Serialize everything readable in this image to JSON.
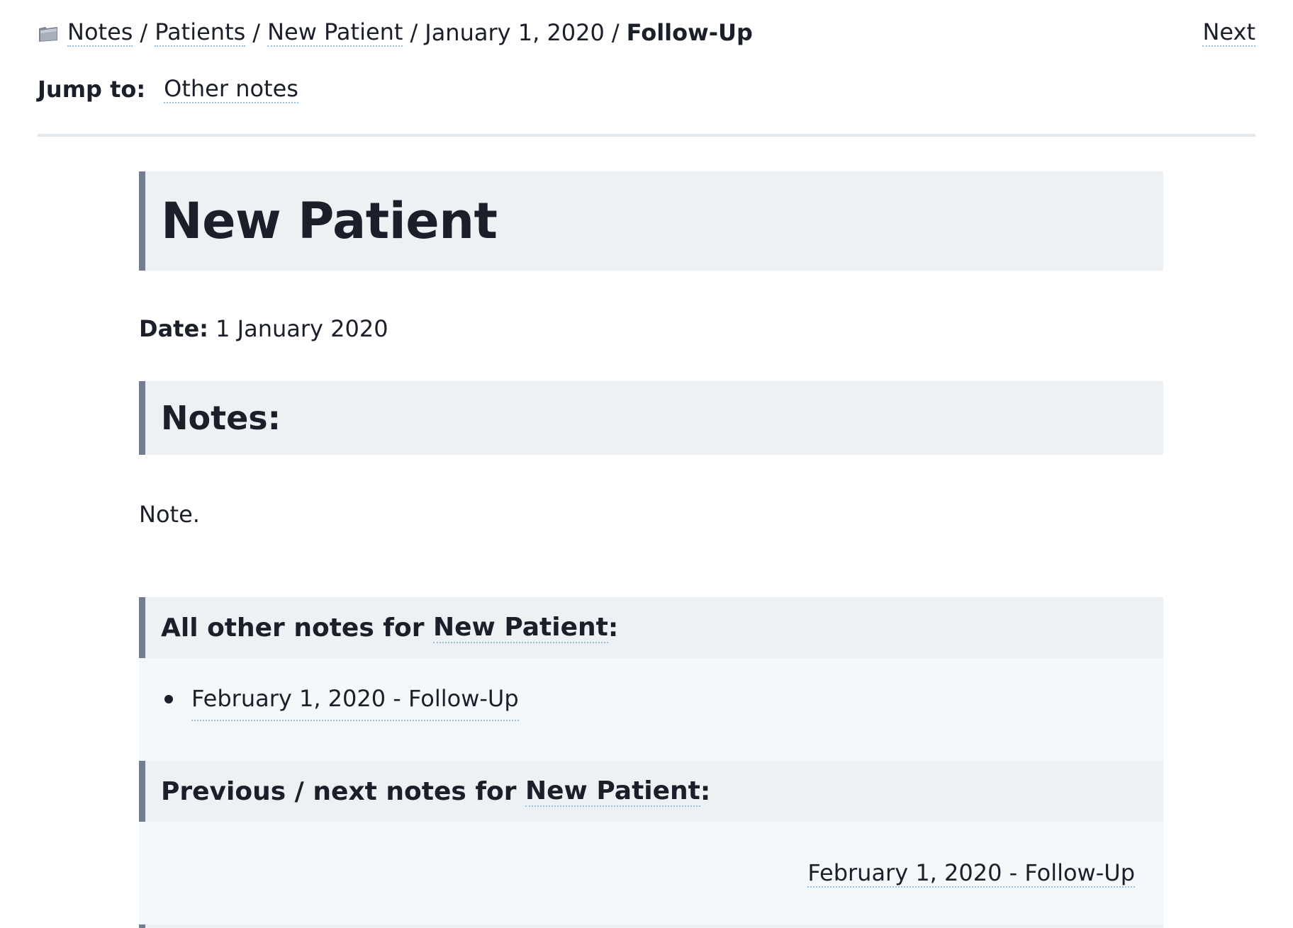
{
  "breadcrumb": {
    "icon": "folder-icon",
    "items": [
      "Notes",
      "Patients",
      "New Patient",
      "January 1, 2020"
    ],
    "separator": "/",
    "current": "Follow-Up"
  },
  "nav": {
    "next_label": "Next"
  },
  "jump": {
    "label": "Jump to:",
    "link": "Other notes"
  },
  "page": {
    "title": "New Patient",
    "date_label": "Date:",
    "date_value": "1 January 2020",
    "notes_heading": "Notes:",
    "note_text": "Note."
  },
  "other_notes": {
    "heading_prefix": "All other notes for",
    "patient_link": "New Patient",
    "heading_suffix": ":",
    "items": [
      "February 1, 2020 - Follow-Up"
    ]
  },
  "prev_next": {
    "heading_prefix": "Previous / next notes for",
    "patient_link": "New Patient",
    "heading_suffix": ":",
    "next_note": "February 1, 2020 - Follow-Up"
  },
  "colors": {
    "text": "#1b1f2a",
    "heading_bg": "#edf1f4",
    "heading_border": "#747c92",
    "section_bg": "#f5f8fb",
    "link_underline": "#9bbfd9",
    "divider": "#e2e8ec"
  }
}
